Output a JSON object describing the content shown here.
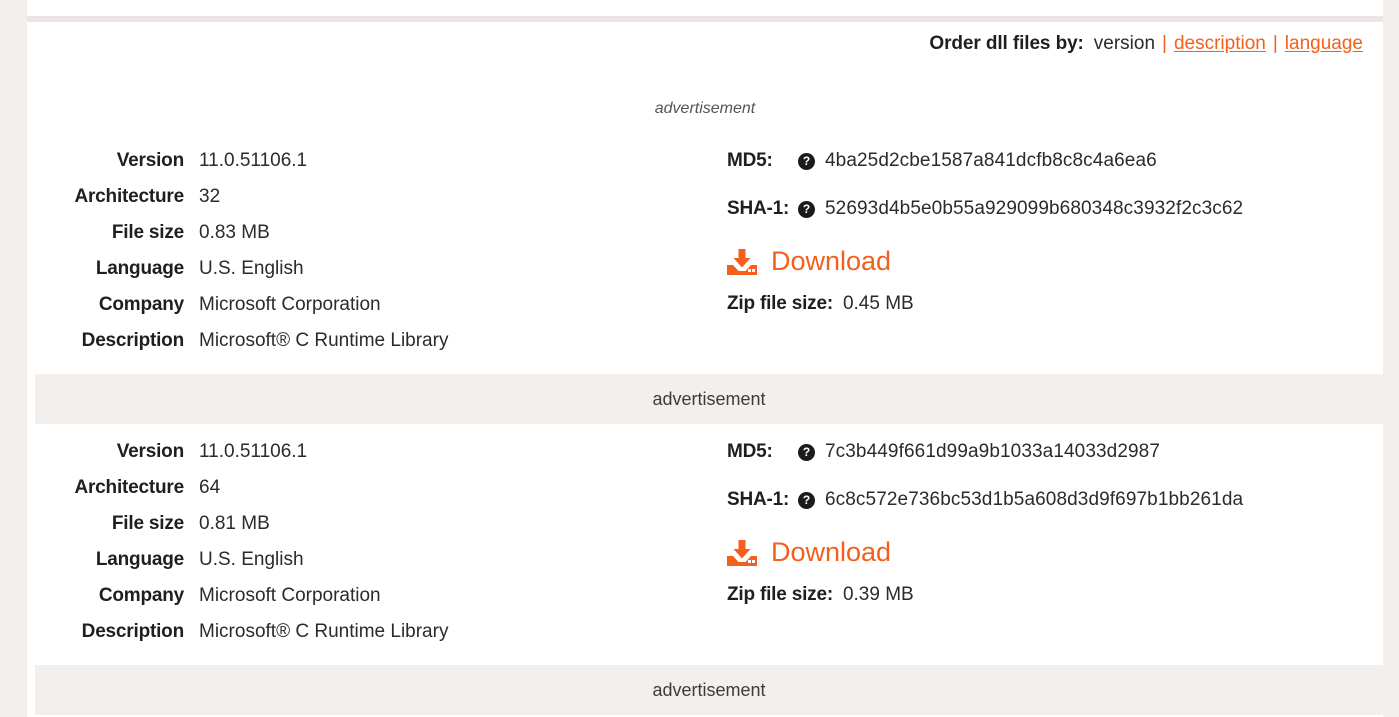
{
  "order": {
    "label": "Order dll files by:",
    "current": "version",
    "sep1": "|",
    "sep2": "|",
    "link_description": "description",
    "link_language": "language"
  },
  "ads": {
    "top": "advertisement",
    "middle": "advertisement",
    "bottom": "advertisement"
  },
  "files": [
    {
      "specs": [
        {
          "key": "Version",
          "value": "11.0.51106.1"
        },
        {
          "key": "Architecture",
          "value": "32"
        },
        {
          "key": "File size",
          "value": "0.83 MB"
        },
        {
          "key": "Language",
          "value": "U.S. English"
        },
        {
          "key": "Company",
          "value": "Microsoft Corporation"
        },
        {
          "key": "Description",
          "value": "Microsoft® C Runtime Library"
        }
      ],
      "md5_label": "MD5:",
      "md5_value": "4ba25d2cbe1587a841dcfb8c8c4a6ea6",
      "sha1_label": "SHA-1:",
      "sha1_value": "52693d4b5e0b55a929099b680348c3932f2c3c62",
      "help_glyph": "?",
      "download_label": "Download",
      "zip_label": "Zip file size:",
      "zip_value": "0.45 MB"
    },
    {
      "specs": [
        {
          "key": "Version",
          "value": "11.0.51106.1"
        },
        {
          "key": "Architecture",
          "value": "64"
        },
        {
          "key": "File size",
          "value": "0.81 MB"
        },
        {
          "key": "Language",
          "value": "U.S. English"
        },
        {
          "key": "Company",
          "value": "Microsoft Corporation"
        },
        {
          "key": "Description",
          "value": "Microsoft® C Runtime Library"
        }
      ],
      "md5_label": "MD5:",
      "md5_value": "7c3b449f661d99a9b1033a14033d2987",
      "sha1_label": "SHA-1:",
      "sha1_value": "6c8c572e736bc53d1b5a608d3d9f697b1bb261da",
      "help_glyph": "?",
      "download_label": "Download",
      "zip_label": "Zip file size:",
      "zip_value": "0.39 MB"
    }
  ],
  "colors": {
    "accent": "#f4601c",
    "page_bg": "#f3efed",
    "card_bg": "#ffffff",
    "text": "#2b2b2b"
  }
}
